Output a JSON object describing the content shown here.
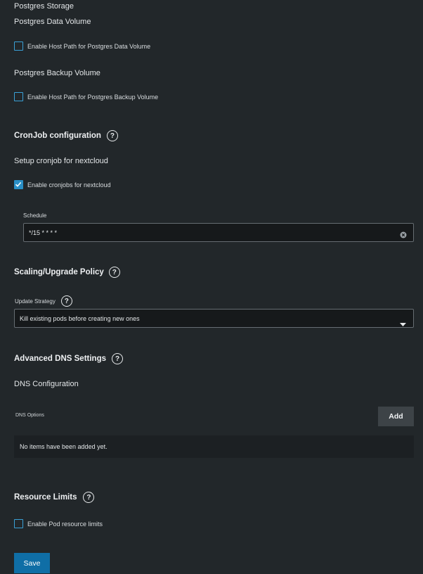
{
  "storage": {
    "section_label": "Postgres Storage",
    "data_volume": {
      "title": "Postgres Data Volume",
      "checkbox_label": "Enable Host Path for Postgres Data Volume",
      "checked": false
    },
    "backup_volume": {
      "title": "Postgres Backup Volume",
      "checkbox_label": "Enable Host Path for Postgres Backup Volume",
      "checked": false
    }
  },
  "cronjob": {
    "heading": "CronJob configuration",
    "subtitle": "Setup cronjob for nextcloud",
    "checkbox_label": "Enable cronjobs for nextcloud",
    "checked": true,
    "schedule_label": "Schedule",
    "schedule_value": "*/15 * * * *"
  },
  "scaling": {
    "heading": "Scaling/Upgrade Policy",
    "strategy_label": "Update Strategy",
    "strategy_value": "Kill existing pods before creating new ones"
  },
  "dns": {
    "heading": "Advanced DNS Settings",
    "subtitle": "DNS Configuration",
    "options_label": "DNS Options",
    "add_label": "Add",
    "empty_text": "No items have been added yet."
  },
  "resources": {
    "heading": "Resource Limits",
    "checkbox_label": "Enable Pod resource limits",
    "checked": false
  },
  "save_label": "Save",
  "colors": {
    "background": "#22272a",
    "accent": "#2a8fc6",
    "save_button": "#0f6ea6"
  },
  "icons": {
    "help": "question-circle-icon",
    "clear": "clear-circle-icon",
    "dropdown": "caret-down-icon",
    "check": "checkmark-icon"
  }
}
